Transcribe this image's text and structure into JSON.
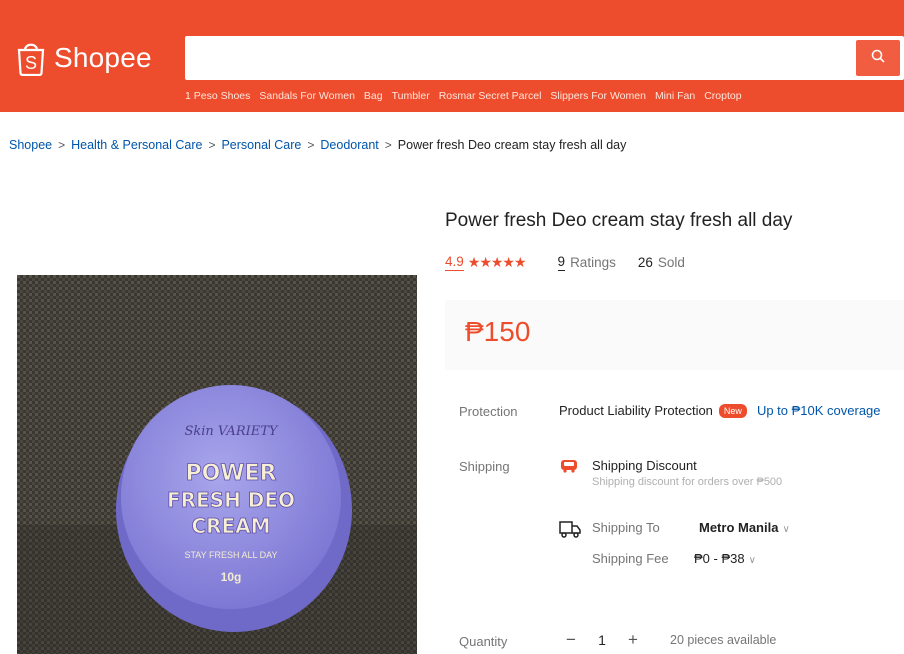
{
  "header": {
    "brand": "Shopee",
    "search_placeholder": "",
    "suggestions": [
      "1 Peso Shoes",
      "Sandals For Women",
      "Bag",
      "Tumbler",
      "Rosmar Secret Parcel",
      "Slippers For Women",
      "Mini Fan",
      "Croptop"
    ]
  },
  "breadcrumb": {
    "items": [
      "Shopee",
      "Health & Personal Care",
      "Personal Care",
      "Deodorant"
    ],
    "current": "Power fresh Deo cream stay fresh all day",
    "separator": ">"
  },
  "image": {
    "label_brand": "Skin VARIETY",
    "label_lines": [
      "POWER",
      "FRESH DEO",
      "CREAM"
    ],
    "label_tagline": "STAY FRESH ALL DAY",
    "label_weight": "10g"
  },
  "product": {
    "title": "Power fresh Deo cream stay fresh all day",
    "rating": "4.9",
    "stars": "★★★★★",
    "rating_count": "9",
    "rating_label": "Ratings",
    "sold_count": "26",
    "sold_label": "Sold",
    "price": "₱150"
  },
  "protection": {
    "label": "Protection",
    "text": "Product Liability Protection",
    "badge": "New",
    "coverage": "Up to ₱10K coverage"
  },
  "shipping": {
    "label": "Shipping",
    "discount_title": "Shipping Discount",
    "discount_sub": "Shipping discount for orders over ₱500",
    "to_label": "Shipping To",
    "to_value": "Metro Manila",
    "fee_label": "Shipping Fee",
    "fee_value": "₱0 - ₱38"
  },
  "quantity": {
    "label": "Quantity",
    "minus": "−",
    "value": "1",
    "plus": "+",
    "available": "20 pieces available"
  },
  "colors": {
    "brand": "#ee4d2d",
    "link": "#0055aa"
  }
}
